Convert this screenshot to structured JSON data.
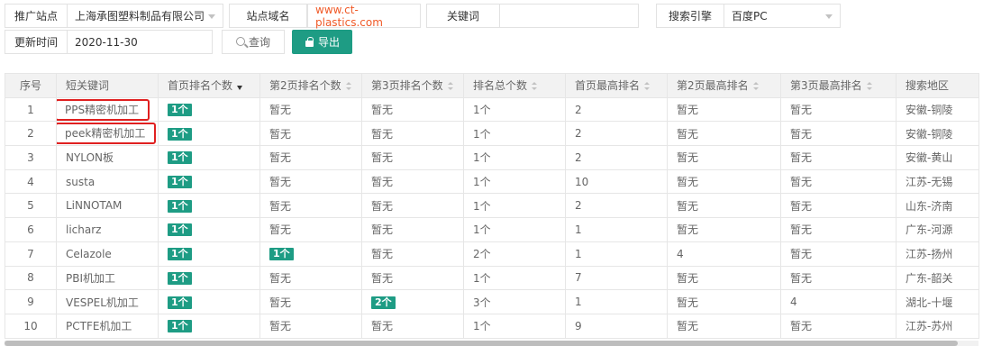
{
  "filters": {
    "site_label": "推广站点",
    "site_value": "上海承图塑料制品有限公司",
    "domain_label": "站点域名",
    "domain_value": "www.ct-plastics.com",
    "keyword_label": "关键词",
    "keyword_value": "",
    "engine_label": "搜索引擎",
    "engine_value": "百度PC",
    "update_label": "更新时间",
    "update_value": "2020-11-30",
    "query_button": "查询",
    "export_button": "导出"
  },
  "table": {
    "headers": [
      "序号",
      "短关键词",
      "首页排名个数",
      "第2页排名个数",
      "第3页排名个数",
      "排名总个数",
      "首页最高排名",
      "第2页最高排名",
      "第3页最高排名",
      "搜索地区"
    ],
    "rows": [
      {
        "no": "1",
        "keyword": "PPS精密机加工",
        "p1": "1个",
        "p2": "暂无",
        "p3": "暂无",
        "total": "1个",
        "best1": "2",
        "best2": "暂无",
        "best3": "暂无",
        "region": "安徽-铜陵"
      },
      {
        "no": "2",
        "keyword": "peek精密机加工",
        "p1": "1个",
        "p2": "暂无",
        "p3": "暂无",
        "total": "1个",
        "best1": "2",
        "best2": "暂无",
        "best3": "暂无",
        "region": "安徽-铜陵"
      },
      {
        "no": "3",
        "keyword": "NYLON板",
        "p1": "1个",
        "p2": "暂无",
        "p3": "暂无",
        "total": "1个",
        "best1": "2",
        "best2": "暂无",
        "best3": "暂无",
        "region": "安徽-黄山"
      },
      {
        "no": "4",
        "keyword": "susta",
        "p1": "1个",
        "p2": "暂无",
        "p3": "暂无",
        "total": "1个",
        "best1": "10",
        "best2": "暂无",
        "best3": "暂无",
        "region": "江苏-无锡"
      },
      {
        "no": "5",
        "keyword": "LiNNOTAM",
        "p1": "1个",
        "p2": "暂无",
        "p3": "暂无",
        "total": "1个",
        "best1": "2",
        "best2": "暂无",
        "best3": "暂无",
        "region": "山东-济南"
      },
      {
        "no": "6",
        "keyword": "licharz",
        "p1": "1个",
        "p2": "暂无",
        "p3": "暂无",
        "total": "1个",
        "best1": "1",
        "best2": "暂无",
        "best3": "暂无",
        "region": "广东-河源"
      },
      {
        "no": "7",
        "keyword": "Celazole",
        "p1": "1个",
        "p2": "1个",
        "p3": "暂无",
        "total": "2个",
        "best1": "1",
        "best2": "4",
        "best3": "暂无",
        "region": "江苏-扬州"
      },
      {
        "no": "8",
        "keyword": "PBI机加工",
        "p1": "1个",
        "p2": "暂无",
        "p3": "暂无",
        "total": "1个",
        "best1": "7",
        "best2": "暂无",
        "best3": "暂无",
        "region": "广东-韶关"
      },
      {
        "no": "9",
        "keyword": "VESPEL机加工",
        "p1": "1个",
        "p2": "暂无",
        "p3": "2个",
        "total": "3个",
        "best1": "1",
        "best2": "暂无",
        "best3": "4",
        "region": "湖北-十堰"
      },
      {
        "no": "10",
        "keyword": "PCTFE机加工",
        "p1": "1个",
        "p2": "暂无",
        "p3": "暂无",
        "total": "1个",
        "best1": "9",
        "best2": "暂无",
        "best3": "暂无",
        "region": "江苏-苏州"
      }
    ]
  },
  "colors": {
    "accent": "#1e9c84",
    "link": "#f05a28",
    "highlight": "#e02020",
    "header_bg": "#f2f2f2"
  }
}
